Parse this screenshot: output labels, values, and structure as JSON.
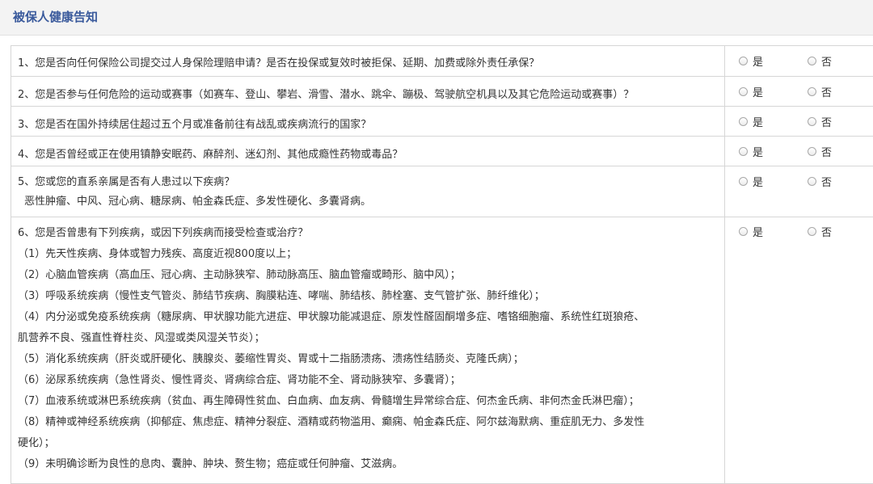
{
  "header": {
    "title": "被保人健康告知"
  },
  "options": {
    "yes": "是",
    "no": "否"
  },
  "questions": [
    {
      "lines": [
        "1、您是否向任何保险公司提交过人身保险理赔申请？是否在投保或复效时被拒保、延期、加费或除外责任承保？"
      ]
    },
    {
      "lines": [
        "2、您是否参与任何危险的运动或赛事（如赛车、登山、攀岩、滑雪、潜水、跳伞、蹦极、驾驶航空机具以及其它危险运动或赛事）？"
      ]
    },
    {
      "lines": [
        "3、您是否在国外持续居住超过五个月或准备前往有战乱或疾病流行的国家？"
      ]
    },
    {
      "lines": [
        "4、您是否曾经或正在使用镇静安眠药、麻醉剂、迷幻剂、其他成瘾性药物或毒品？"
      ]
    },
    {
      "lines": [
        "5、您或您的直系亲属是否有人患过以下疾病？",
        "恶性肿瘤、中风、冠心病、糖尿病、帕金森氏症、多发性硬化、多囊肾病。"
      ]
    },
    {
      "lines": [
        "6、您是否曾患有下列疾病，或因下列疾病而接受检查或治疗？",
        "（1）先天性疾病、身体或智力残疾、高度近视800度以上；",
        "（2）心脑血管疾病（高血压、冠心病、主动脉狭窄、肺动脉高压、脑血管瘤或畸形、脑中风）；",
        "（3）呼吸系统疾病（慢性支气管炎、肺结节疾病、胸膜粘连、哮喘、肺结核、肺栓塞、支气管扩张、肺纤维化）；",
        "（4）内分泌或免疫系统疾病（糖尿病、甲状腺功能亢进症、甲状腺功能减退症、原发性醛固酮增多症、嗜铬细胞瘤、系统性红斑狼疮、",
        "肌营养不良、强直性脊柱炎、风湿或类风湿关节炎）；",
        "（5）消化系统疾病（肝炎或肝硬化、胰腺炎、萎缩性胃炎、胃或十二指肠溃疡、溃疡性结肠炎、克隆氏病）；",
        "（6）泌尿系统疾病（急性肾炎、慢性肾炎、肾病综合症、肾功能不全、肾动脉狭窄、多囊肾）；",
        "（7）血液系统或淋巴系统疾病（贫血、再生障碍性贫血、白血病、血友病、骨髓增生异常综合症、何杰金氏病、非何杰金氏淋巴瘤）；",
        "（8）精神或神经系统疾病（抑郁症、焦虑症、精神分裂症、酒精或药物滥用、癫痫、帕金森氏症、阿尔兹海默病、重症肌无力、多发性",
        "硬化）；",
        "（9）未明确诊断为良性的息肉、囊肿、肿块、赘生物；癌症或任何肿瘤、艾滋病。"
      ]
    }
  ]
}
